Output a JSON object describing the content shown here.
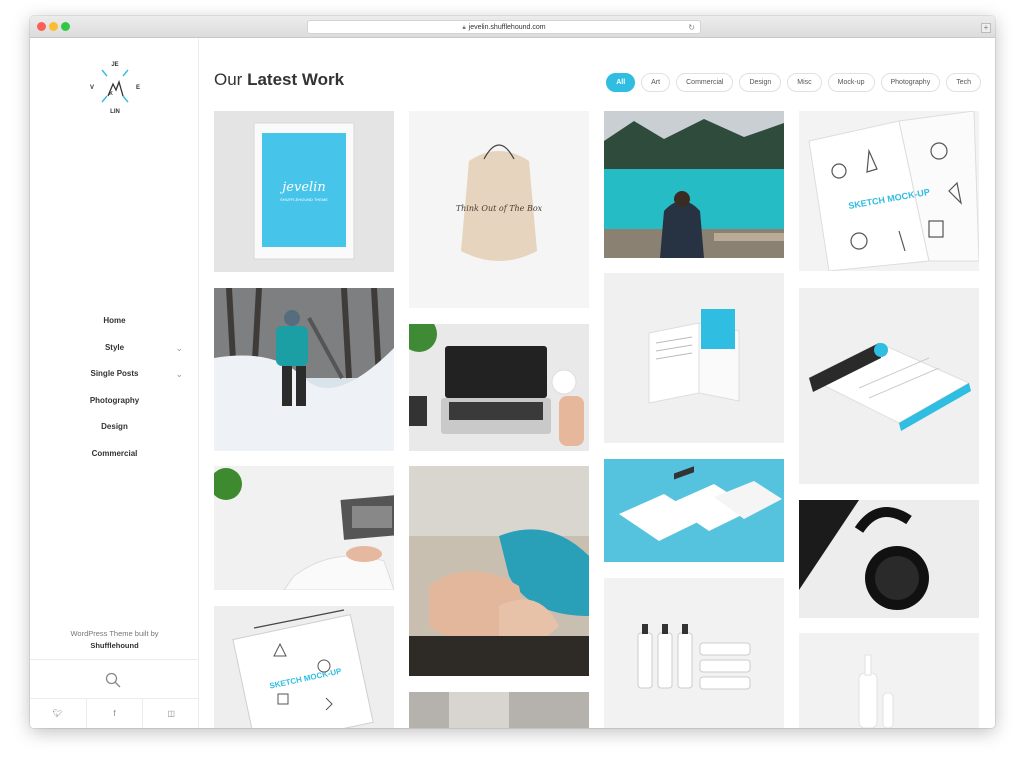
{
  "browser": {
    "url": "jevelin.shufflehound.com"
  },
  "sidebar": {
    "logo_letters": [
      "JE",
      "V",
      "E",
      "K",
      "LIN"
    ],
    "nav": [
      {
        "label": "Home",
        "has_submenu": false
      },
      {
        "label": "Style",
        "has_submenu": true
      },
      {
        "label": "Single Posts",
        "has_submenu": true
      },
      {
        "label": "Photography",
        "has_submenu": false
      },
      {
        "label": "Design",
        "has_submenu": false
      },
      {
        "label": "Commercial",
        "has_submenu": false
      }
    ],
    "credit_line": "WordPress Theme built by",
    "credit_author": "Shufflehound"
  },
  "main": {
    "heading_light": "Our",
    "heading_bold": "Latest Work",
    "filters": [
      "All",
      "Art",
      "Commercial",
      "Design",
      "Misc",
      "Mock-up",
      "Photography",
      "Tech"
    ],
    "active_filter": "All",
    "frame_text": "jevelin",
    "frame_subtext": "SHUFFLEHOUND THEME",
    "bag_text": "Think Out of The Box",
    "sketch_text": "SKETCH MOCK-UP",
    "sketch_text2": "SKETCH MOCK-UP"
  },
  "colors": {
    "accent": "#2fbde1",
    "text": "#333333"
  }
}
